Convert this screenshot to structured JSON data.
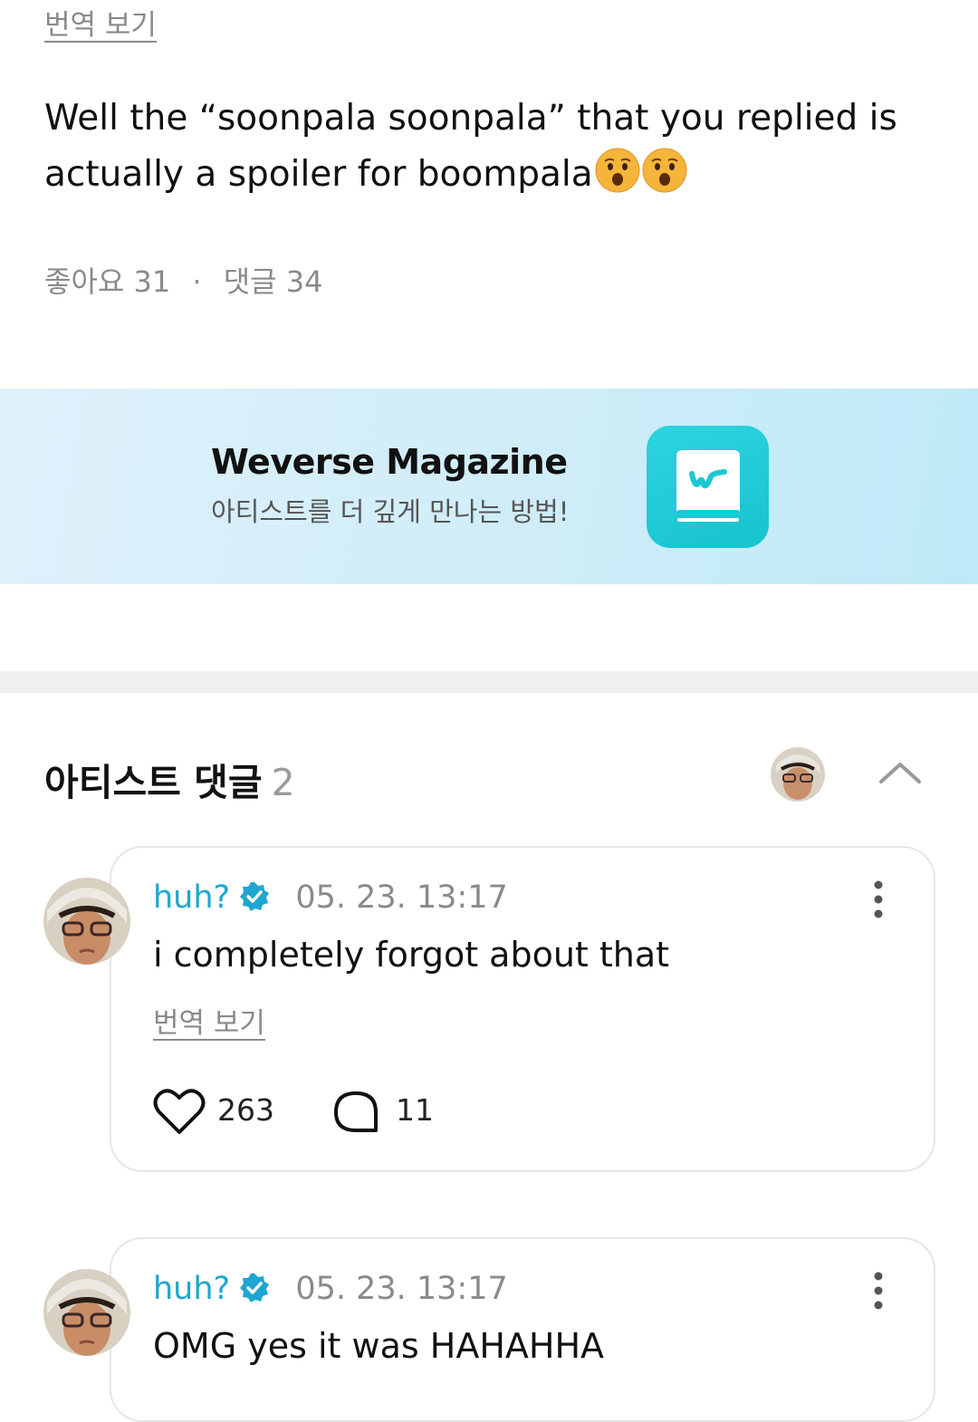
{
  "post": {
    "translate_label": "번역 보기",
    "text": "Well the “soonpala soonpala” that you replied is actually a spoiler for boompala",
    "emoji": [
      "hushed-face",
      "hushed-face"
    ],
    "likes_label": "좋아요",
    "likes_count": "31",
    "comments_label": "댓글",
    "comments_count": "34"
  },
  "banner": {
    "title": "Weverse Magazine",
    "subtitle": "아티스트를 더 깊게 만나는 방법!",
    "icon": "weverse-magazine-icon",
    "icon_color": "#1cc8d4"
  },
  "artist_comments": {
    "title": "아티스트 댓글",
    "count": "2",
    "items": [
      {
        "author": "huh?",
        "verified": true,
        "timestamp": "05. 23. 13:17",
        "text": "i completely forgot about that",
        "translate_label": "번역 보기",
        "likes": "263",
        "replies": "11"
      },
      {
        "author": "huh?",
        "verified": true,
        "timestamp": "05. 23. 13:17",
        "text": "OMG yes it was HAHAHHA"
      }
    ]
  },
  "colors": {
    "accent": "#1ea6d1",
    "muted": "#8a8a8a",
    "banner_bg": "#d2eef9"
  }
}
